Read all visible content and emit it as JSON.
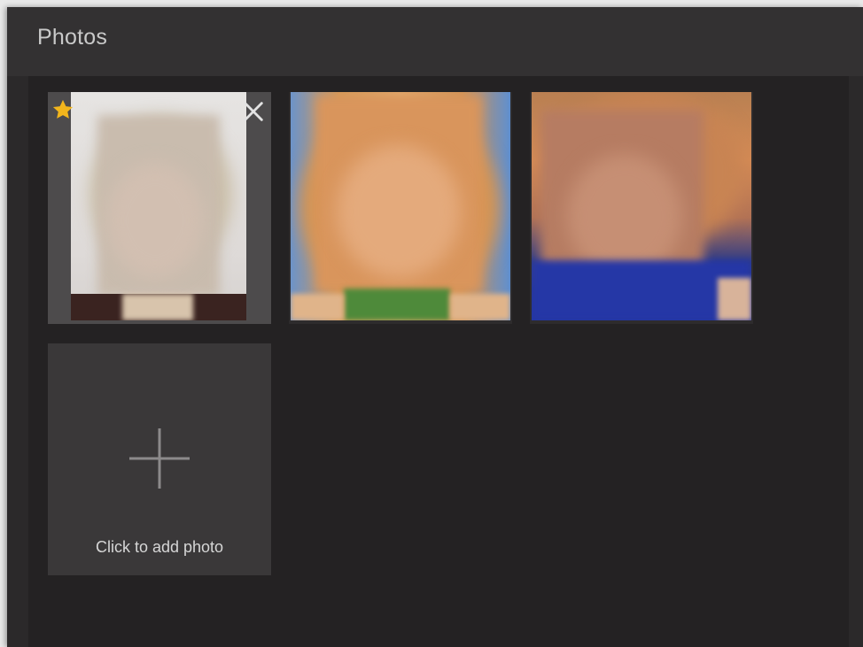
{
  "header": {
    "title": "Photos"
  },
  "photos": [
    {
      "primary": true,
      "remove_icon": "close-icon",
      "primary_icon": "star-icon"
    },
    {
      "primary": false
    },
    {
      "primary": false
    }
  ],
  "add_photo": {
    "label": "Click to add photo",
    "icon": "plus-icon"
  },
  "colors": {
    "window_bg": "#2b292a",
    "header_bg": "#333132",
    "content_bg": "#242223",
    "add_tile_bg": "#3a3839",
    "star": "#f2b51c",
    "text": "#c9c9c9"
  }
}
